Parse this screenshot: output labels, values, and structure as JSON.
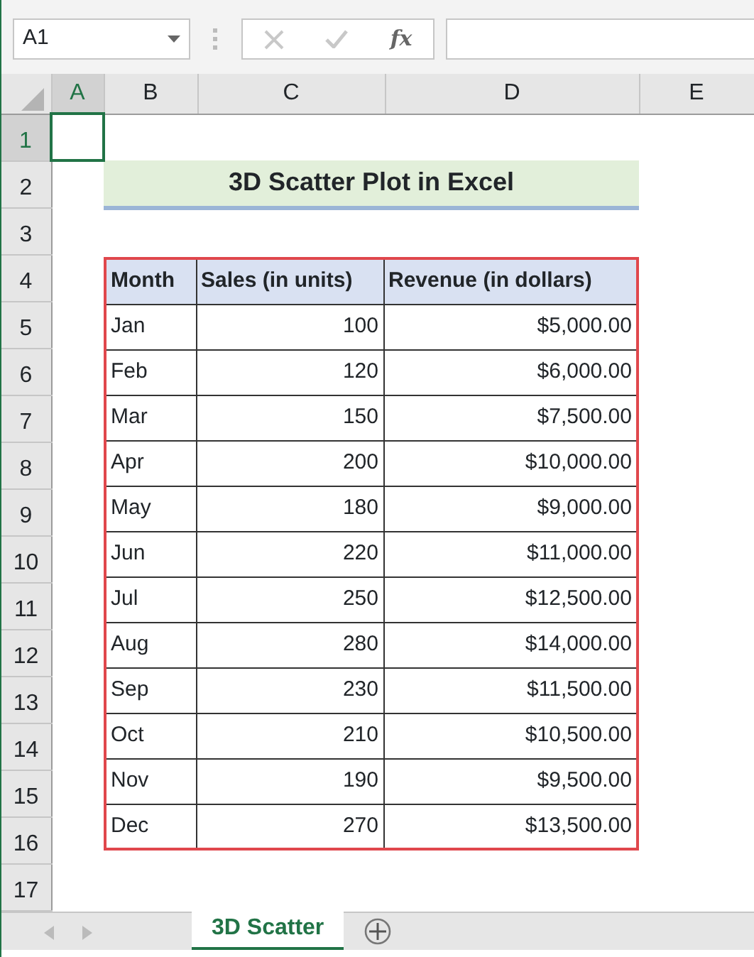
{
  "name_box": {
    "value": "A1"
  },
  "formula_bar": {
    "function_label": "fx"
  },
  "columns": [
    {
      "label": "A",
      "selected": true
    },
    {
      "label": "B",
      "selected": false
    },
    {
      "label": "C",
      "selected": false
    },
    {
      "label": "D",
      "selected": false
    },
    {
      "label": "E",
      "selected": false
    }
  ],
  "rows": [
    {
      "label": "1",
      "selected": true
    },
    {
      "label": "2",
      "selected": false
    },
    {
      "label": "3",
      "selected": false
    },
    {
      "label": "4",
      "selected": false
    },
    {
      "label": "5",
      "selected": false
    },
    {
      "label": "6",
      "selected": false
    },
    {
      "label": "7",
      "selected": false
    },
    {
      "label": "8",
      "selected": false
    },
    {
      "label": "9",
      "selected": false
    },
    {
      "label": "10",
      "selected": false
    },
    {
      "label": "11",
      "selected": false
    },
    {
      "label": "12",
      "selected": false
    },
    {
      "label": "13",
      "selected": false
    },
    {
      "label": "14",
      "selected": false
    },
    {
      "label": "15",
      "selected": false
    },
    {
      "label": "16",
      "selected": false
    },
    {
      "label": "17",
      "selected": false
    }
  ],
  "title": "3D Scatter Plot in Excel",
  "table": {
    "columns": [
      "Month",
      "Sales (in units)",
      "Revenue (in dollars)"
    ],
    "rows": [
      [
        "Jan",
        "100",
        "$5,000.00"
      ],
      [
        "Feb",
        "120",
        "$6,000.00"
      ],
      [
        "Mar",
        "150",
        "$7,500.00"
      ],
      [
        "Apr",
        "200",
        "$10,000.00"
      ],
      [
        "May",
        "180",
        "$9,000.00"
      ],
      [
        "Jun",
        "220",
        "$11,000.00"
      ],
      [
        "Jul",
        "250",
        "$12,500.00"
      ],
      [
        "Aug",
        "280",
        "$14,000.00"
      ],
      [
        "Sep",
        "230",
        "$11,500.00"
      ],
      [
        "Oct",
        "210",
        "$10,500.00"
      ],
      [
        "Nov",
        "190",
        "$9,500.00"
      ],
      [
        "Dec",
        "270",
        "$13,500.00"
      ]
    ]
  },
  "sheet_tabs": [
    {
      "label": "3D Scatter",
      "selected": true
    }
  ]
}
